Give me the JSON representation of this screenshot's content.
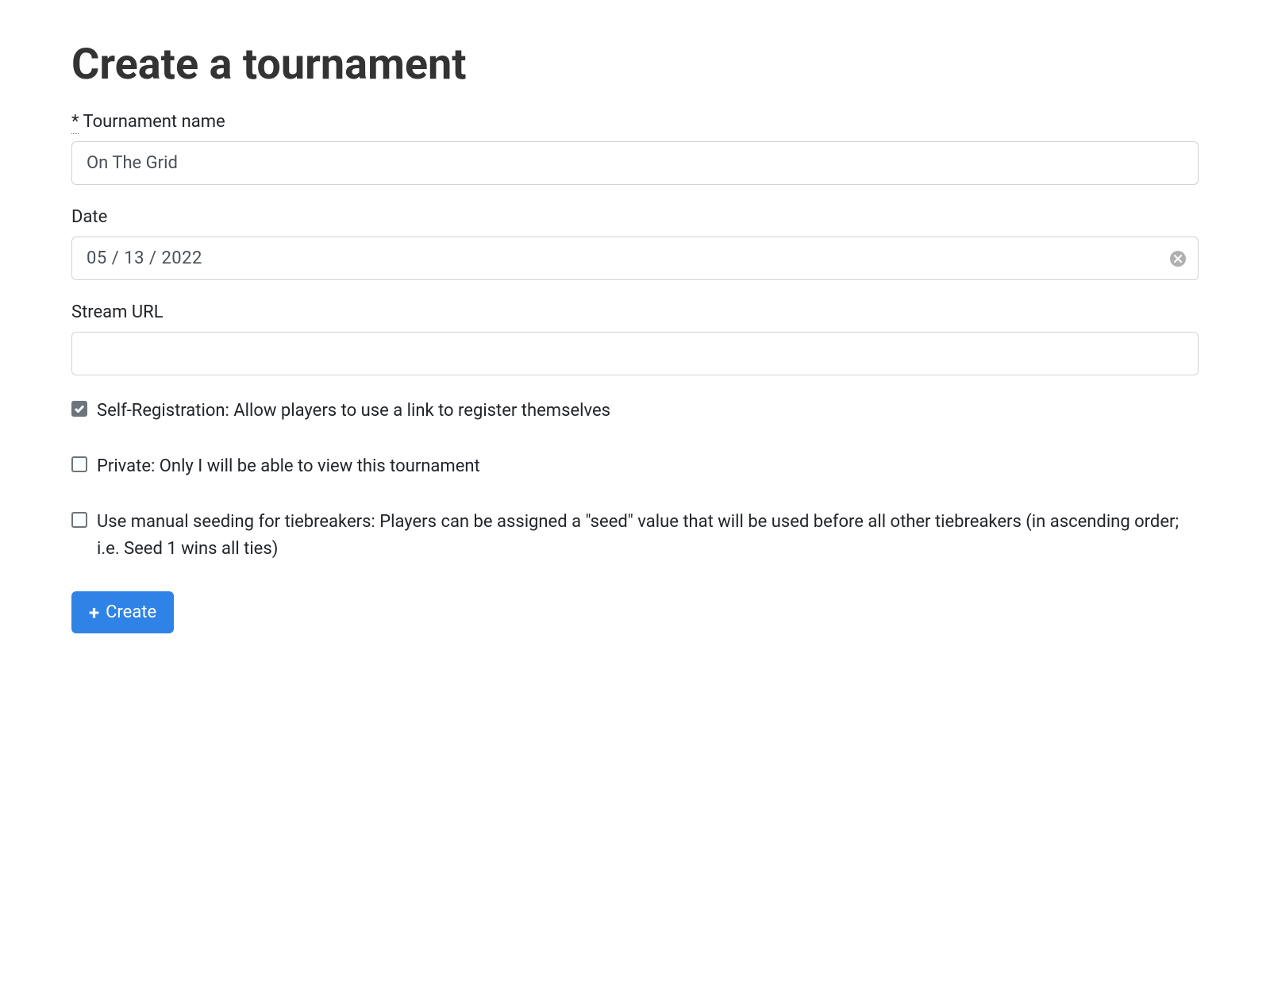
{
  "page": {
    "title": "Create a tournament"
  },
  "form": {
    "name": {
      "label": "Tournament name",
      "required_mark": "*",
      "value": "On The Grid"
    },
    "date": {
      "label": "Date",
      "value": "05 / 13 / 2022"
    },
    "stream_url": {
      "label": "Stream URL",
      "value": ""
    },
    "self_registration": {
      "label": "Self-Registration: Allow players to use a link to register themselves",
      "checked": true
    },
    "private": {
      "label": "Private: Only I will be able to view this tournament",
      "checked": false
    },
    "manual_seeding": {
      "label": "Use manual seeding for tiebreakers: Players can be assigned a \"seed\" value that will be used before all other tiebreakers (in ascending order; i.e. Seed 1 wins all ties)",
      "checked": false
    },
    "submit": {
      "label": "Create"
    }
  }
}
